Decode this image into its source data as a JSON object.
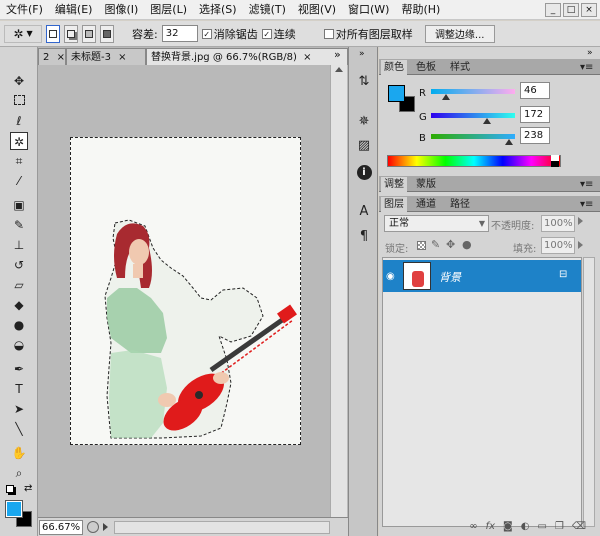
{
  "menu": [
    "文件(F)",
    "编辑(E)",
    "图像(I)",
    "图层(L)",
    "选择(S)",
    "滤镜(T)",
    "视图(V)",
    "窗口(W)",
    "帮助(H)"
  ],
  "window_buttons": [
    "_",
    "□",
    "×"
  ],
  "options": {
    "tolerance_label": "容差:",
    "tolerance_value": "32",
    "antialias_label": "消除锯齿",
    "contiguous_label": "连续",
    "sample_all_label": "对所有图层取样",
    "refine_edge_label": "调整边缘...",
    "checkmark": "✓"
  },
  "doc_tabs": [
    {
      "label": "2",
      "close": "×"
    },
    {
      "label": "未标题-3",
      "close": "×"
    },
    {
      "label": "替换背景.jpg @ 66.7%(RGB/8)",
      "close": "×"
    }
  ],
  "doc_tabs_more": "»",
  "status": {
    "zoom": "66.67%"
  },
  "color_panel": {
    "tabs": [
      "颜色",
      "色板",
      "样式"
    ],
    "channels": [
      {
        "label": "R",
        "value": "46",
        "fraction": 0.18
      },
      {
        "label": "G",
        "value": "172",
        "fraction": 0.67
      },
      {
        "label": "B",
        "value": "238",
        "fraction": 0.93
      }
    ],
    "foreground": "#1aa7ef",
    "background": "#000000"
  },
  "adjust_tabs": [
    "调整",
    "蒙版"
  ],
  "layers_panel": {
    "tabs": [
      "图层",
      "通道",
      "路径"
    ],
    "blend_mode": "正常",
    "opacity_label": "不透明度:",
    "opacity_value": "100%",
    "lock_label": "锁定:",
    "fill_label": "填充:",
    "fill_value": "100%",
    "layer_name": "背景",
    "selected_color": "#1e82c8"
  },
  "panel_menu": "▾≡",
  "colors": {
    "accent": "#1aa7ef",
    "guitar": "#e01b1b",
    "selection": "#1e82c8"
  }
}
